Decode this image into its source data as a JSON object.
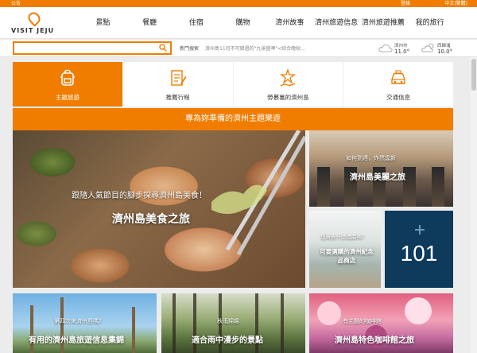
{
  "topbar": {
    "notice": "公告",
    "login": "登錄",
    "language": "中文(繁體)"
  },
  "header": {
    "logo_text": "VISIT JEJU",
    "nav": [
      "景點",
      "餐廳",
      "住宿",
      "購物",
      "濟州故事",
      "濟州旅遊信息",
      "濟州旅遊推薦",
      "我的旅行"
    ]
  },
  "search": {
    "value": "",
    "placeholder": "",
    "news_label": "新鬥搜索",
    "news_text": "濟州島11月不可錯過的\"九景盛啤\"<綜合晚秋..."
  },
  "weather": [
    {
      "city": "濟州市",
      "temp": "11.0°",
      "icon": "cloud-icon"
    },
    {
      "city": "西歸浦",
      "temp": "10.0°",
      "icon": "cloud-sun-icon"
    }
  ],
  "tabs": [
    {
      "label": "主題旅遊",
      "icon": "backpack-icon",
      "active": true
    },
    {
      "label": "推薦行程",
      "icon": "checklist-icon",
      "active": false
    },
    {
      "label": "勞慕裏的濟州島",
      "icon": "star-hand-icon",
      "active": false
    },
    {
      "label": "交通信息",
      "icon": "car-icon",
      "active": false
    }
  ],
  "banner": {
    "text": "專為妳準備的濟州主題樂遊"
  },
  "cards": {
    "food": {
      "sub": "跟隨人氣節目的腳步探尋濟州島美食！",
      "main": "濟州島美食之旅"
    },
    "streets": {
      "sub": "如何到達，炸然雲新",
      "main": "濟州島美麗之旅"
    },
    "gift": {
      "sub": "想買些什麼禮品嗎?",
      "main": "可要選購的濟州紀念品商店"
    },
    "counter": {
      "value": "101"
    },
    "palm": {
      "sub": "第四次來濟州島嗎?",
      "main": "有用的濟州島旅遊信息集錦"
    },
    "forest": {
      "sub": "秋雨綿綿",
      "main": "適合雨中漫步的景點"
    },
    "cafe": {
      "sub": "有主題的咖啡館",
      "main": "濟州島特色咖啡館之旅"
    }
  },
  "colors": {
    "accent": "#f07d00",
    "dark_tile": "#0e3a5c"
  }
}
